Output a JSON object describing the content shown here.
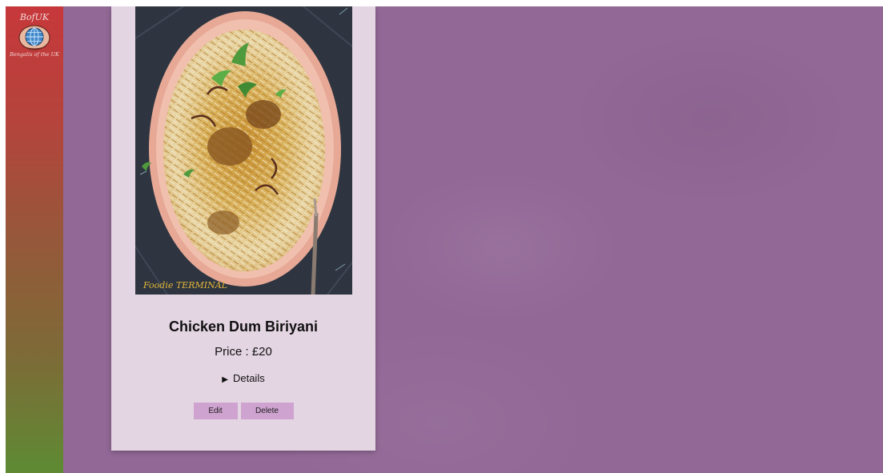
{
  "logo": {
    "top_text": "BofUK",
    "bottom_text": "Bengalis of the UK",
    "icon": "globe-icon"
  },
  "card": {
    "image_icon": "food-photo",
    "image_watermark": "Foodie TERMINAL",
    "title": "Chicken Dum Biriyani",
    "price": "Price : £20",
    "details_caret": "▶",
    "details_label": "Details",
    "edit_label": "Edit",
    "delete_label": "Delete"
  },
  "colors": {
    "background": "#926896",
    "card": "#e4d5e3",
    "button": "#cfa3d0",
    "sidebar_top": "#c7383b",
    "sidebar_bottom": "#5e8b33"
  }
}
